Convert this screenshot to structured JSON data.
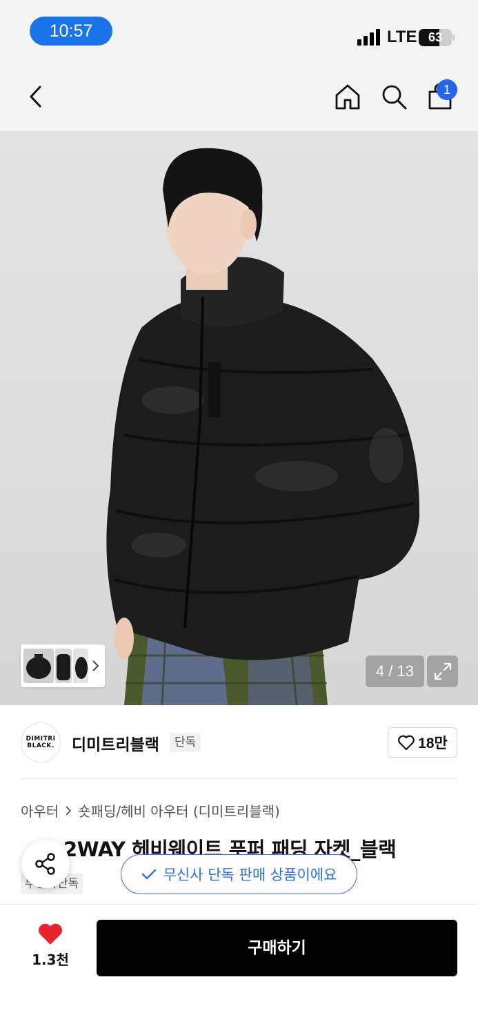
{
  "status_bar": {
    "time": "10:57",
    "network": "LTE",
    "battery": "63",
    "battery_level": 0.63
  },
  "nav": {
    "back_icon": "chevron-left-icon",
    "home_icon": "home-icon",
    "search_icon": "search-icon",
    "cart_icon": "shopping-bag-icon",
    "cart_badge": "1"
  },
  "gallery": {
    "counter": "4 / 13",
    "expand_icon": "expand-icon",
    "thumb_next_icon": "chevron-right-icon"
  },
  "brand": {
    "logo_line1": "DIMITRI",
    "logo_line2": "BLACK.",
    "name": "디미트리블랙",
    "tag": "단독",
    "like_count": "18만",
    "like_icon": "heart-outline-icon"
  },
  "breadcrumb": {
    "category": "아우터",
    "subcategory": "숏패딩/헤비 아우터 (디미트리블랙)"
  },
  "product": {
    "title": "2WAY 헤비웨이트 푸퍼 패딩 자켓_블랙",
    "exclusive_tag": "무신사단독"
  },
  "toast": {
    "message": "무신사 단독 판매 상품이에요"
  },
  "bottom_bar": {
    "wish_count": "1.3천",
    "buy_label": "구매하기"
  },
  "colors": {
    "accent_blue": "#2f6fde",
    "heart_red": "#e8232b",
    "buy_button": "#000000"
  }
}
